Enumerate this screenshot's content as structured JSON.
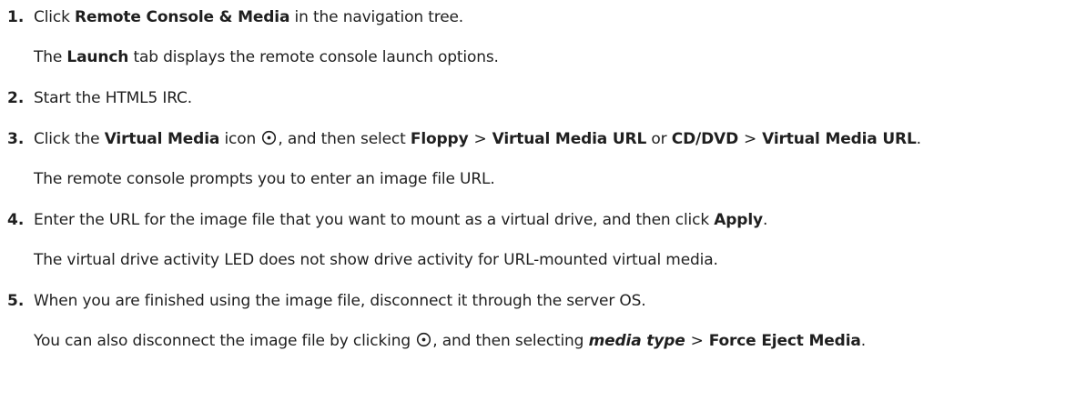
{
  "steps": [
    {
      "number": "1.",
      "segments": [
        {
          "t": "Click ",
          "b": false
        },
        {
          "t": "Remote Console & Media",
          "b": true
        },
        {
          "t": " in the navigation tree.",
          "b": false
        }
      ],
      "note": "The Launch tab displays the remote console launch options.",
      "note_segments": [
        {
          "t": "The ",
          "b": false
        },
        {
          "t": "Launch",
          "b": true
        },
        {
          "t": " tab displays the remote console launch options.",
          "b": false
        }
      ]
    },
    {
      "number": "2.",
      "segments": [
        {
          "t": "Start the HTML5 IRC.",
          "b": false
        }
      ]
    },
    {
      "number": "3.",
      "segments": [
        {
          "t": "Click the ",
          "b": false
        },
        {
          "t": "Virtual Media",
          "b": true
        },
        {
          "t": " icon ",
          "b": false
        },
        {
          "icon": "virtual-media-icon"
        },
        {
          "t": ", and then select ",
          "b": false
        },
        {
          "t": "Floppy",
          "b": true
        },
        {
          "sep": ">"
        },
        {
          "t": "Virtual Media URL",
          "b": true
        },
        {
          "t": " or ",
          "b": false
        },
        {
          "t": "CD/DVD",
          "b": true
        },
        {
          "sep": ">"
        },
        {
          "t": "Virtual Media URL",
          "b": true
        },
        {
          "t": ".",
          "b": false
        }
      ],
      "note": "The remote console prompts you to enter an image file URL.",
      "note_segments": [
        {
          "t": "The remote console prompts you to enter an image file URL.",
          "b": false
        }
      ]
    },
    {
      "number": "4.",
      "segments": [
        {
          "t": "Enter the URL for the image file that you want to mount as a virtual drive, and then click ",
          "b": false
        },
        {
          "t": "Apply",
          "b": true
        },
        {
          "t": ".",
          "b": false
        }
      ],
      "note": "The virtual drive activity LED does not show drive activity for URL-mounted virtual media.",
      "note_segments": [
        {
          "t": "The virtual drive activity LED does not show drive activity for URL-mounted virtual media.",
          "b": false
        }
      ]
    },
    {
      "number": "5.",
      "segments": [
        {
          "t": "When you are finished using the image file, disconnect it through the server OS.",
          "b": false
        }
      ],
      "note": "You can also disconnect the image file by clicking ⊙, and then selecting media type > Force Eject Media.",
      "note_segments": [
        {
          "t": "You can also disconnect the image file by clicking ",
          "b": false
        },
        {
          "icon": "virtual-media-icon"
        },
        {
          "t": ", and then selecting ",
          "b": false
        },
        {
          "t": "media type",
          "bi": true
        },
        {
          "sep": ">"
        },
        {
          "t": "Force Eject Media",
          "b": true
        },
        {
          "t": ".",
          "b": false
        }
      ]
    }
  ]
}
